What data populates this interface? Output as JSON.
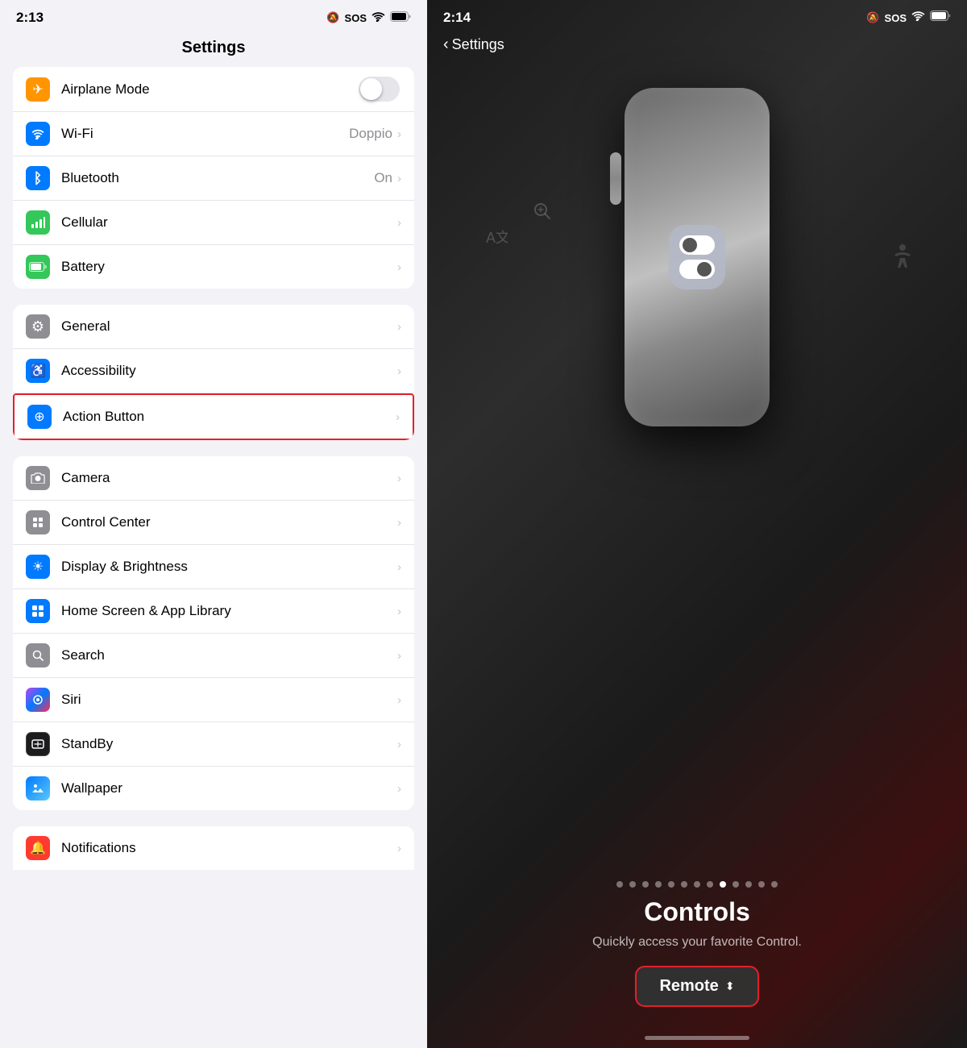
{
  "left": {
    "status_bar": {
      "time": "2:13",
      "bell_icon": "🔕",
      "sos": "SOS",
      "wifi": "wifi",
      "battery": "battery"
    },
    "title": "Settings",
    "group1": {
      "rows": [
        {
          "id": "airplane",
          "label": "Airplane Mode",
          "icon_type": "orange",
          "icon_glyph": "✈",
          "has_toggle": true,
          "toggle_on": false,
          "value": "",
          "has_chevron": false
        },
        {
          "id": "wifi",
          "label": "Wi-Fi",
          "icon_type": "blue",
          "icon_glyph": "📶",
          "has_toggle": false,
          "value": "Doppio",
          "has_chevron": true
        },
        {
          "id": "bluetooth",
          "label": "Bluetooth",
          "icon_type": "bluetooth",
          "icon_glyph": "⬡",
          "has_toggle": false,
          "value": "On",
          "has_chevron": true
        },
        {
          "id": "cellular",
          "label": "Cellular",
          "icon_type": "green-cell",
          "icon_glyph": "📡",
          "has_toggle": false,
          "value": "",
          "has_chevron": true
        },
        {
          "id": "battery",
          "label": "Battery",
          "icon_type": "green-bat",
          "icon_glyph": "🔋",
          "has_toggle": false,
          "value": "",
          "has_chevron": true
        }
      ]
    },
    "group2": {
      "rows": [
        {
          "id": "general",
          "label": "General",
          "icon_type": "gray",
          "icon_glyph": "⚙",
          "highlighted": false,
          "value": "",
          "has_chevron": true
        },
        {
          "id": "accessibility",
          "label": "Accessibility",
          "icon_type": "blue-access",
          "icon_glyph": "♿",
          "highlighted": false,
          "value": "",
          "has_chevron": true
        },
        {
          "id": "action-button",
          "label": "Action Button",
          "icon_type": "blue-action",
          "icon_glyph": "✛",
          "highlighted": true,
          "value": "",
          "has_chevron": true
        }
      ]
    },
    "group3": {
      "rows": [
        {
          "id": "camera",
          "label": "Camera",
          "icon_type": "gray-camera",
          "icon_glyph": "📷",
          "value": "",
          "has_chevron": true
        },
        {
          "id": "control-center",
          "label": "Control Center",
          "icon_type": "gray-control",
          "icon_glyph": "⊞",
          "value": "",
          "has_chevron": true
        },
        {
          "id": "display-brightness",
          "label": "Display & Brightness",
          "icon_type": "blue-display",
          "icon_glyph": "☀",
          "value": "",
          "has_chevron": true
        },
        {
          "id": "home-screen",
          "label": "Home Screen & App Library",
          "icon_type": "blue-home",
          "icon_glyph": "⊞",
          "value": "",
          "has_chevron": true
        },
        {
          "id": "search",
          "label": "Search",
          "icon_type": "gray-search",
          "icon_glyph": "🔍",
          "value": "",
          "has_chevron": true
        },
        {
          "id": "siri",
          "label": "Siri",
          "icon_type": "siri",
          "icon_glyph": "◉",
          "value": "",
          "has_chevron": true
        },
        {
          "id": "standby",
          "label": "StandBy",
          "icon_type": "standby",
          "icon_glyph": "◐",
          "value": "",
          "has_chevron": true
        },
        {
          "id": "wallpaper",
          "label": "Wallpaper",
          "icon_type": "wallpaper",
          "icon_glyph": "⬡",
          "value": "",
          "has_chevron": true
        }
      ]
    },
    "group4": {
      "rows": [
        {
          "id": "notifications",
          "label": "Notifications",
          "icon_type": "notif",
          "icon_glyph": "🔔",
          "value": "",
          "has_chevron": true
        }
      ]
    }
  },
  "right": {
    "status_bar": {
      "time": "2:14",
      "bell_icon": "🔕",
      "sos": "SOS",
      "wifi": "wifi",
      "battery": "battery"
    },
    "nav": {
      "back_label": "Settings"
    },
    "pagination": {
      "total": 13,
      "active_index": 8
    },
    "controls_title": "Controls",
    "controls_subtitle": "Quickly access your favorite Control.",
    "remote_button_label": "Remote",
    "remote_button_chevron": "⬍"
  }
}
